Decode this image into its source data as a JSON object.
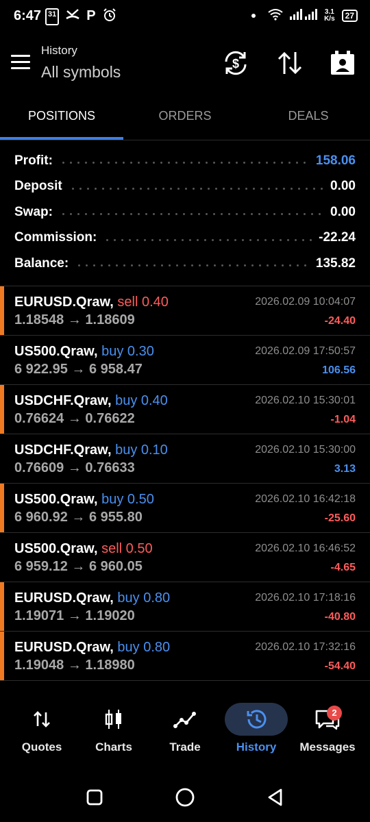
{
  "status_bar": {
    "time": "6:47",
    "icons": [
      "calendar-31-icon",
      "missed-call-icon",
      "parking-p-icon",
      "alarm-icon"
    ],
    "calendar_day": "31",
    "p_glyph": "P",
    "net_speed_top": "3.1",
    "net_speed_bottom": "K/s",
    "battery": "27"
  },
  "header": {
    "title": "History",
    "subtitle": "All symbols"
  },
  "tabs": [
    {
      "label": "POSITIONS",
      "active": true
    },
    {
      "label": "ORDERS",
      "active": false
    },
    {
      "label": "DEALS",
      "active": false
    }
  ],
  "summary": [
    {
      "label": "Profit:",
      "value": "158.06"
    },
    {
      "label": "Deposit",
      "value": "0.00"
    },
    {
      "label": "Swap:",
      "value": "0.00"
    },
    {
      "label": "Commission:",
      "value": "-22.24"
    },
    {
      "label": "Balance:",
      "value": "135.82"
    }
  ],
  "positions": [
    {
      "symbol": "EURUSD.Qraw,",
      "side": "sell 0.40",
      "open": "1.18548",
      "close": "1.18609",
      "arrow": "→",
      "time": "2026.02.09 10:04:07",
      "profit": "-24.40"
    },
    {
      "symbol": "US500.Qraw,",
      "side": "buy 0.30",
      "open": "6 922.95",
      "close": "6 958.47",
      "arrow": "→",
      "time": "2026.02.09 17:50:57",
      "profit": "106.56"
    },
    {
      "symbol": "USDCHF.Qraw,",
      "side": "buy 0.40",
      "open": "0.76624",
      "close": "0.76622",
      "arrow": "→",
      "time": "2026.02.10 15:30:01",
      "profit": "-1.04"
    },
    {
      "symbol": "USDCHF.Qraw,",
      "side": "buy 0.10",
      "open": "0.76609",
      "close": "0.76633",
      "arrow": "→",
      "time": "2026.02.10 15:30:00",
      "profit": "3.13"
    },
    {
      "symbol": "US500.Qraw,",
      "side": "buy 0.50",
      "open": "6 960.92",
      "close": "6 955.80",
      "arrow": "→",
      "time": "2026.02.10 16:42:18",
      "profit": "-25.60"
    },
    {
      "symbol": "US500.Qraw,",
      "side": "sell 0.50",
      "open": "6 959.12",
      "close": "6 960.05",
      "arrow": "→",
      "time": "2026.02.10 16:46:52",
      "profit": "-4.65"
    },
    {
      "symbol": "EURUSD.Qraw,",
      "side": "buy 0.80",
      "open": "1.19071",
      "close": "1.19020",
      "arrow": "→",
      "time": "2026.02.10 17:18:16",
      "profit": "-40.80"
    },
    {
      "symbol": "EURUSD.Qraw,",
      "side": "buy 0.80",
      "open": "1.19048",
      "close": "1.18980",
      "arrow": "→",
      "time": "2026.02.10 17:32:16",
      "profit": "-54.40"
    }
  ],
  "bottom_nav": [
    {
      "label": "Quotes",
      "icon": "quotes-arrows-icon",
      "active": false
    },
    {
      "label": "Charts",
      "icon": "candlestick-icon",
      "active": false
    },
    {
      "label": "Trade",
      "icon": "trade-line-icon",
      "active": false
    },
    {
      "label": "History",
      "icon": "history-clock-icon",
      "active": true
    },
    {
      "label": "Messages",
      "icon": "message-bubble-icon",
      "active": false,
      "badge": "2"
    }
  ],
  "colors": {
    "accent_blue": "#4a90f0",
    "loss_red": "#ff5c5c",
    "position_marker_orange": "#f07a22",
    "background": "#000000"
  }
}
